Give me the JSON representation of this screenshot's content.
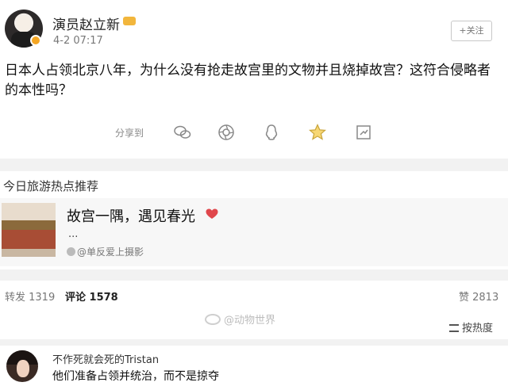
{
  "post": {
    "author": "演员赵立新",
    "time": "4-2 07:17",
    "follow_label": "+关注",
    "text": "日本人占领北京八年，为什么没有抢走故宫里的文物并且烧掉故宫？这符合侵略者的本性吗？"
  },
  "share": {
    "label": "分享到",
    "icons": [
      "wechat-icon",
      "moments-icon",
      "qq-icon",
      "qzone-icon",
      "link-icon"
    ]
  },
  "recommend": {
    "title": "今日旅游热点推荐",
    "card": {
      "title": "故宫一隅，遇见春光",
      "ellipsis": "...",
      "source": "@单反爱上摄影"
    }
  },
  "stats": {
    "repost": "转发 1319",
    "comment": "评论 1578",
    "like": "赞 2813"
  },
  "watermark": "@动物世界",
  "sort_label": "按热度",
  "comment": {
    "name": "不作死就会死的Tristan",
    "text": "他们准备占领并统治，而不是掠夺"
  },
  "colors": {
    "accent_orange": "#f5a623",
    "heart_red": "#e0474c",
    "band_gray": "#f2f2f2"
  }
}
